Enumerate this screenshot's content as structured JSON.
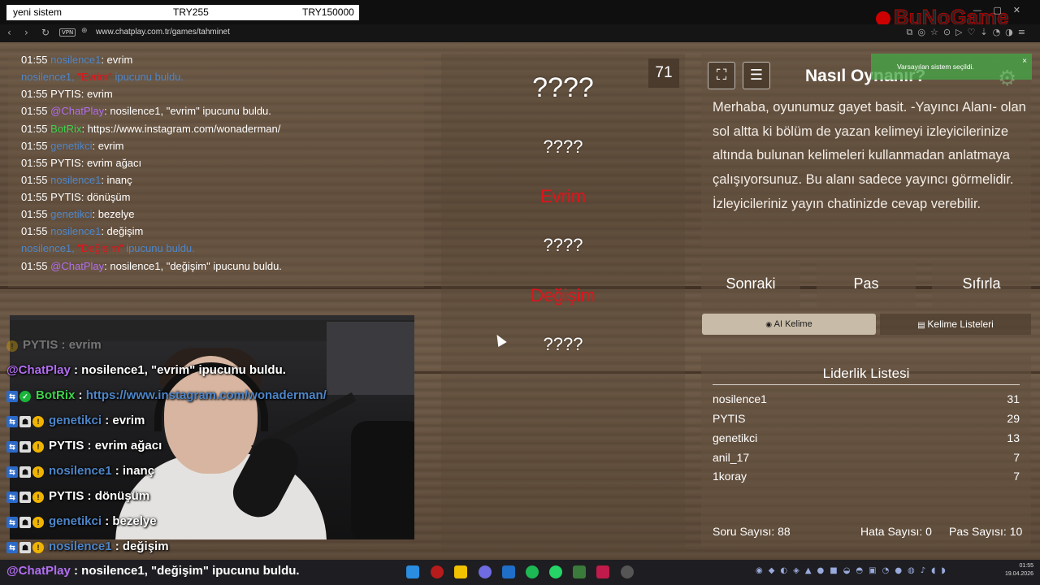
{
  "overlay_bar": {
    "label": "yeni sistem",
    "amount_1": "TRY255",
    "amount_2": "TRY150000"
  },
  "brand": {
    "logo_text": "BuNoGame"
  },
  "browser": {
    "url": "www.chatplay.com.tr/games/tahminet",
    "vpn": "VPN"
  },
  "chat_log": [
    {
      "time": "01:55",
      "user": "nosilence1",
      "user_color": "blue",
      "sep": ": ",
      "text": "evrim"
    },
    {
      "time": "",
      "user": "nosilence1, ",
      "user_color": "blue",
      "quoted": "\"Evrim\"",
      "text": " ipucunu buldu.",
      "system": true
    },
    {
      "time": "01:55",
      "user": "PYTIS",
      "user_color": "white",
      "sep": ": ",
      "text": "evrim"
    },
    {
      "time": "01:55",
      "user": "@ChatPlay",
      "user_color": "purple",
      "sep": ": ",
      "text": "nosilence1, \"evrim\" ipucunu buldu."
    },
    {
      "time": "01:55",
      "user": "BotRix",
      "user_color": "green",
      "sep": ": ",
      "text": "https://www.instagram.com/wonaderman/"
    },
    {
      "time": "01:55",
      "user": "genetikci",
      "user_color": "blue",
      "sep": ": ",
      "text": "evrim"
    },
    {
      "time": "01:55",
      "user": "PYTIS",
      "user_color": "white",
      "sep": ": ",
      "text": "evrim ağacı"
    },
    {
      "time": "01:55",
      "user": "nosilence1",
      "user_color": "blue",
      "sep": ": ",
      "text": "inanç"
    },
    {
      "time": "01:55",
      "user": "PYTIS",
      "user_color": "white",
      "sep": ": ",
      "text": "dönüşüm"
    },
    {
      "time": "01:55",
      "user": "genetikci",
      "user_color": "blue",
      "sep": ": ",
      "text": "bezelye"
    },
    {
      "time": "01:55",
      "user": "nosilence1",
      "user_color": "blue",
      "sep": ": ",
      "text": "değişim"
    },
    {
      "time": "",
      "user": "nosilence1, ",
      "user_color": "blue",
      "quoted": "\"Değişim\"",
      "text": " ipucunu buldu.",
      "system": true
    },
    {
      "time": "01:55",
      "user": "@ChatPlay",
      "user_color": "purple",
      "sep": ": ",
      "text": "nosilence1, \"değişim\" ipucunu buldu."
    }
  ],
  "stream_overlay": [
    {
      "user": "PYTIS",
      "text": " : evrim",
      "color": "white",
      "badges": [
        "gold"
      ],
      "faded": true
    },
    {
      "user": "@ChatPlay",
      "text": " : nosilence1, \"evrim\" ipucunu buldu.",
      "color": "purple",
      "badges": []
    },
    {
      "user": "BotRix",
      "text": " : ",
      "link": "https://www.instagram.com/wonaderman/",
      "color": "green",
      "badges": [
        "blue",
        "green"
      ]
    },
    {
      "user": "genetikci",
      "text": " : evrim",
      "color": "blue",
      "badges": [
        "blue",
        "gray",
        "gold"
      ]
    },
    {
      "user": "PYTIS",
      "text": " : evrim ağacı",
      "color": "white",
      "badges": [
        "blue",
        "gray",
        "gold"
      ]
    },
    {
      "user": "nosilence1",
      "text": " : inanç",
      "color": "blue",
      "badges": [
        "blue",
        "gray",
        "gold"
      ]
    },
    {
      "user": "PYTIS",
      "text": " : dönüşüm",
      "color": "white",
      "badges": [
        "blue",
        "gray",
        "gold"
      ]
    },
    {
      "user": "genetikci",
      "text": " : bezelye",
      "color": "blue",
      "badges": [
        "blue",
        "gray",
        "gold"
      ]
    },
    {
      "user": "nosilence1",
      "text": " : değişim",
      "color": "blue",
      "badges": [
        "blue",
        "gray",
        "gold"
      ]
    }
  ],
  "game": {
    "timer": "71",
    "words": [
      {
        "text": "????",
        "state": "hidden",
        "size": "big"
      },
      {
        "text": "????",
        "state": "hidden"
      },
      {
        "text": "Evrim",
        "state": "found"
      },
      {
        "text": "????",
        "state": "hidden"
      },
      {
        "text": "Değişim",
        "state": "found"
      },
      {
        "text": "????",
        "state": "hidden"
      }
    ]
  },
  "howto": {
    "title": "Nasıl Oynanır?",
    "text": "Merhaba, oyunumuz gayet basit. -Yayıncı Alanı- olan sol altta ki bölüm de yazan kelimeyi izleyicilerinize altında bulunan kelimeleri kullanmadan anlatmaya çalışıyorsunuz. Bu alanı sadece yayıncı görmelidir. İzleyicileriniz yayın chatinizde cevap verebilir."
  },
  "toast": {
    "message": "Varsayılan sistem seçildi.",
    "close": "×"
  },
  "controls": {
    "next": "Sonraki",
    "pass": "Pas",
    "reset": "Sıfırla",
    "ai_word": "AI Kelime",
    "word_lists": "Kelime Listeleri"
  },
  "leaderboard": {
    "title": "Liderlik Listesi",
    "rows": [
      {
        "name": "nosilence1",
        "score": "31"
      },
      {
        "name": "PYTIS",
        "score": "29"
      },
      {
        "name": "genetikci",
        "score": "13"
      },
      {
        "name": "anil_17",
        "score": "7"
      },
      {
        "name": "1koray",
        "score": "7"
      }
    ]
  },
  "stats": {
    "questions": "Soru Sayısı: 88",
    "errors": "Hata Sayısı: 0",
    "passes": "Pas Sayısı: 10"
  },
  "taskbar": {
    "chat_user": "@ChatPlay",
    "chat_text": " : nosilence1, \"değişim\" ipucunu buldu.",
    "time": "01:55",
    "date": "19.04.2026"
  },
  "colors": {
    "blue": "#4e86c9",
    "purple": "#b26ef0",
    "green": "#3fd14d",
    "red": "#e0141b",
    "white": "#ffffff",
    "toast": "#46a546"
  }
}
